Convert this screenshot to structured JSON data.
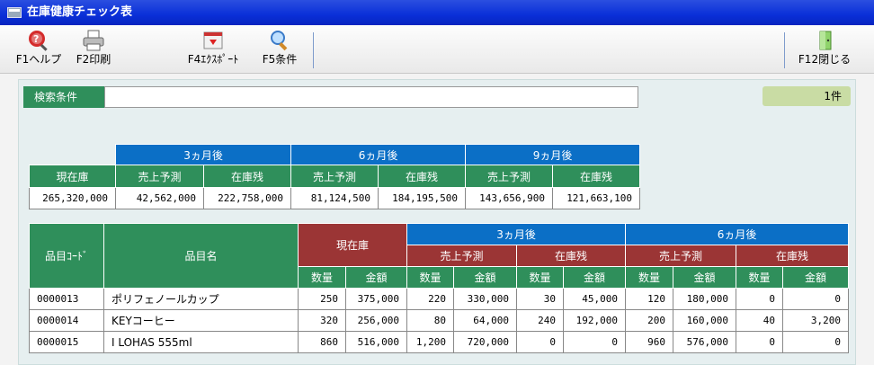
{
  "window": {
    "title": "在庫健康チェック表"
  },
  "toolbar": {
    "help_label": "F1ヘルプ",
    "print_label": "F2印刷",
    "export_label": "F4ｴｸｽﾎﾟｰﾄ",
    "condition_label": "F5条件",
    "close_label": "F12閉じる"
  },
  "search": {
    "label": "検索条件",
    "value": "",
    "count": "1件"
  },
  "summary": {
    "groups": [
      "3ヵ月後",
      "6ヵ月後",
      "9ヵ月後"
    ],
    "header_stock": "現在庫",
    "header_sales": "売上予測",
    "header_remain": "在庫残",
    "values": [
      "265,320,000",
      "42,562,000",
      "222,758,000",
      "81,124,500",
      "184,195,500",
      "143,656,900",
      "121,663,100"
    ]
  },
  "detail": {
    "headers": {
      "code": "品目ｺｰﾄﾞ",
      "name": "品目名",
      "stock": "現在庫",
      "after3": "3ヵ月後",
      "after6": "6ヵ月後",
      "sales": "売上予測",
      "remain": "在庫残",
      "qty": "数量",
      "amount": "金額"
    },
    "rows": [
      {
        "code": "0000013",
        "name": "ポリフェノールカップ",
        "cells": [
          "250",
          "375,000",
          "220",
          "330,000",
          "30",
          "45,000",
          "120",
          "180,000",
          "0",
          "0"
        ]
      },
      {
        "code": "0000014",
        "name": "KEYコーヒー",
        "cells": [
          "320",
          "256,000",
          "80",
          "64,000",
          "240",
          "192,000",
          "200",
          "160,000",
          "40",
          "3,200"
        ]
      },
      {
        "code": "0000015",
        "name": "I LOHAS 555ml",
        "cells": [
          "860",
          "516,000",
          "1,200",
          "720,000",
          "0",
          "0",
          "960",
          "576,000",
          "0",
          "0"
        ]
      }
    ]
  }
}
